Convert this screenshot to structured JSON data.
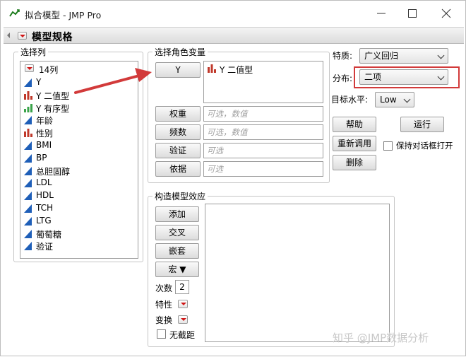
{
  "window": {
    "title": "拟合模型 - JMP Pro"
  },
  "header": {
    "title": "模型规格"
  },
  "columns": {
    "title": "选择列",
    "count": "14列",
    "items": [
      {
        "label": "Y",
        "type": "continuous"
      },
      {
        "label": "Y 二值型",
        "type": "nominal"
      },
      {
        "label": "Y 有序型",
        "type": "ordinal"
      },
      {
        "label": "年龄",
        "type": "continuous"
      },
      {
        "label": "性别",
        "type": "nominal"
      },
      {
        "label": "BMI",
        "type": "continuous"
      },
      {
        "label": "BP",
        "type": "continuous"
      },
      {
        "label": "总胆固醇",
        "type": "continuous"
      },
      {
        "label": "LDL",
        "type": "continuous"
      },
      {
        "label": "HDL",
        "type": "continuous"
      },
      {
        "label": "TCH",
        "type": "continuous"
      },
      {
        "label": "LTG",
        "type": "continuous"
      },
      {
        "label": "葡萄糖",
        "type": "continuous"
      },
      {
        "label": "验证",
        "type": "continuous"
      }
    ]
  },
  "roles": {
    "title": "选择角色变量",
    "y_label": "Y",
    "y_value": "Y 二值型",
    "weight_label": "权重",
    "weight_placeholder": "可选，数值",
    "freq_label": "频数",
    "freq_placeholder": "可选，数值",
    "validation_label": "验证",
    "validation_placeholder": "可选",
    "by_label": "依据",
    "by_placeholder": "可选"
  },
  "effects": {
    "title": "构造模型效应",
    "add": "添加",
    "cross": "交叉",
    "nest": "嵌套",
    "macro": "宏 ▼",
    "degree_label": "次数",
    "degree_value": "2",
    "attributes_label": "特性",
    "transform_label": "变换",
    "no_intercept_label": "无截距"
  },
  "options": {
    "personality_label": "特质:",
    "personality_value": "广义回归",
    "distribution_label": "分布:",
    "distribution_value": "二项",
    "target_label": "目标水平:",
    "target_value": "Low",
    "help": "帮助",
    "run": "运行",
    "recall": "重新调用",
    "keep_open_label": "保持对话框打开",
    "remove": "删除"
  },
  "watermark": "知乎 @JMP数据分析",
  "colors": {
    "nominal": "#c0392b",
    "ordinal": "#3aa34a",
    "continuous": "#1f5fb8",
    "highlight": "#d23a3a"
  }
}
